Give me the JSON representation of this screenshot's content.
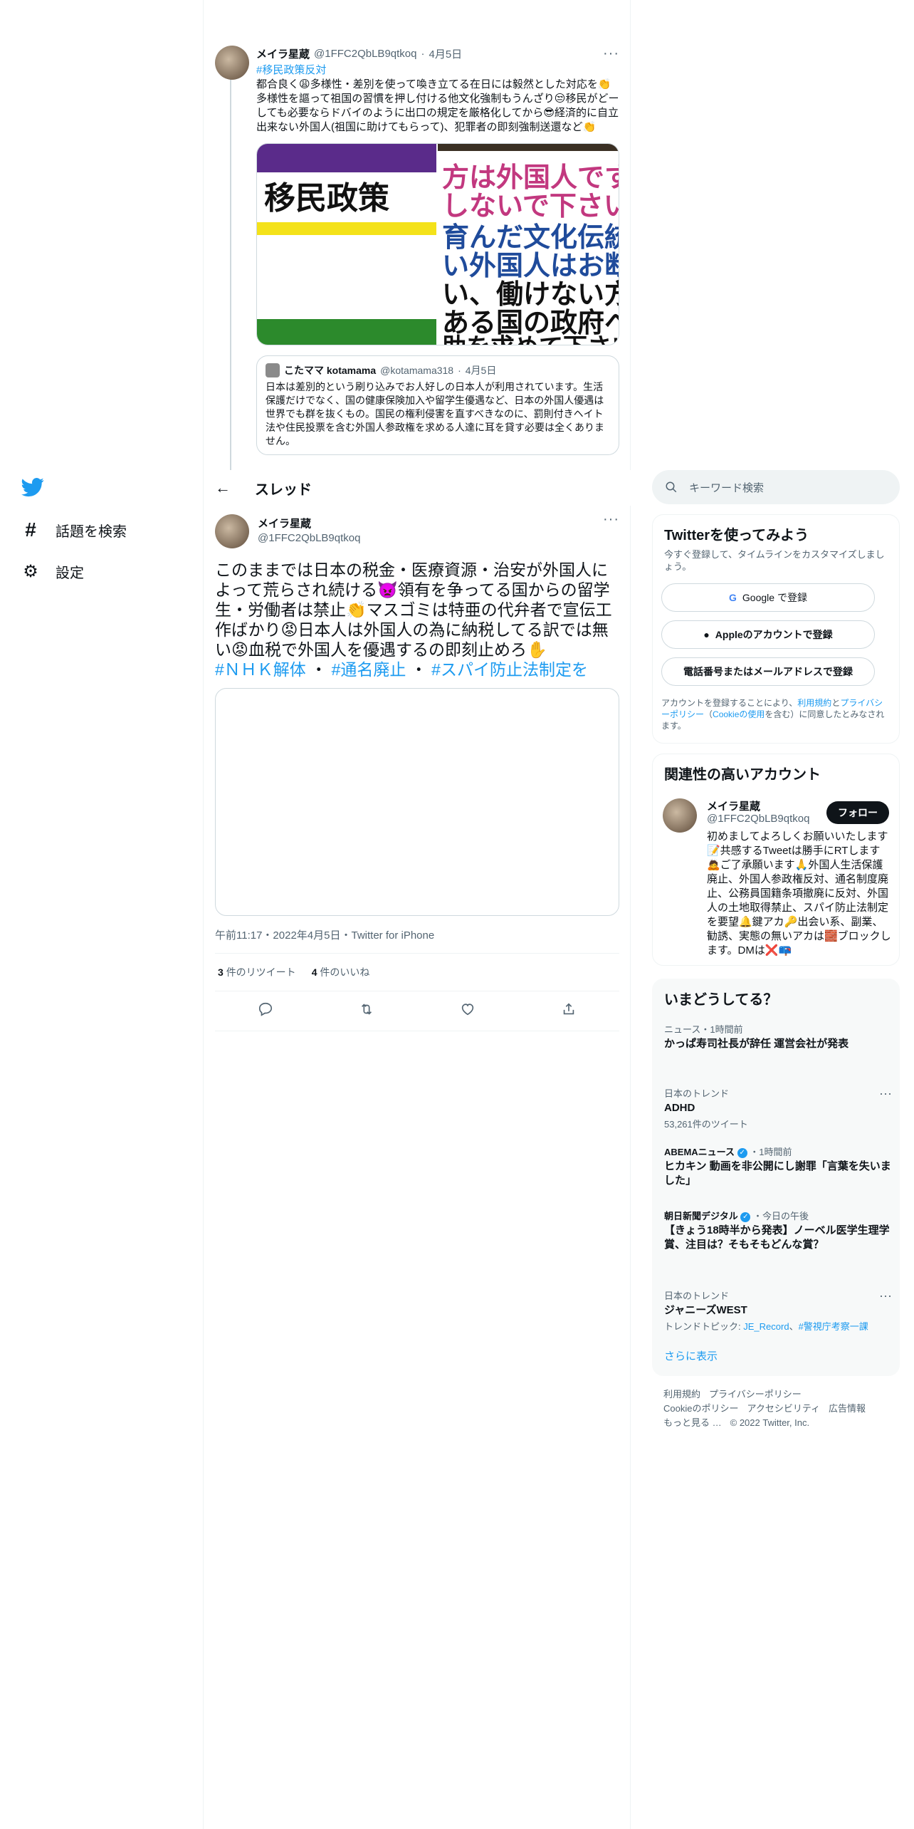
{
  "nav": {
    "logo": "twitter-logo",
    "items": [
      {
        "icon": "#",
        "label": "話題を検索"
      },
      {
        "icon": "⚙",
        "label": "設定"
      }
    ]
  },
  "prev_tweet": {
    "name": "メイラ星蔵",
    "handle": "@1FFC2QbLB9qtkoq",
    "date": "4月5日",
    "hashtag": "#移民政策反対",
    "text": "都合良く😩多様性・差別を使って喚き立てる在日には毅然とした対応を👏多様性を謳って祖国の習慣を押し付ける他文化強制もうんざり😒移民がどーしても必要ならドバイのように出口の規定を厳格化してから😎経済的に自立出来ない外国人(祖国に助けてもらって)、犯罪者の即刻強制送還など👏",
    "image1_text": "移民政策",
    "image2_lines": [
      "方は外国人です",
      "しないで下さい",
      "育んだ文化伝統を",
      "い外国人はお断り",
      "い、働けない方は",
      "ある国の政府へと",
      "助を求めて下さい"
    ],
    "quote": {
      "name": "こたママ kotamama",
      "handle": "@kotamama318",
      "date": "4月5日",
      "text": "日本は差別的という刷り込みでお人好しの日本人が利用されています。生活保護だけでなく、国の健康保険加入や留学生優遇など、日本の外国人優遇は世界でも群を抜くもの。国民の権利侵害を直すべきなのに、罰則付きヘイト法や住民投票を含む外国人参政権を求める人達に耳を貸す必要は全くありません。"
    }
  },
  "header": {
    "back": "←",
    "title": "スレッド"
  },
  "main_tweet": {
    "name": "メイラ星蔵",
    "handle": "@1FFC2QbLB9qtkoq",
    "text": "このままでは日本の税金・医療資源・治安が外国人によって荒らされ続ける👿領有を争ってる国からの留学生・労働者は禁止👏マスゴミは特亜の代弁者で宣伝工作ばかり😡日本人は外国人の為に納税してる訳では無い😡血税で外国人を優遇するの即刻止めろ✋",
    "hashtags": [
      "#ＮＨＫ解体",
      "#通名廃止",
      "#スパイ防止法制定を"
    ],
    "meta": "午前11:17・2022年4月5日・Twitter for iPhone",
    "retweets": "3",
    "retweets_label": "件のリツイート",
    "likes": "4",
    "likes_label": "件のいいね"
  },
  "search": {
    "placeholder": "キーワード検索"
  },
  "signup": {
    "title": "Twitterを使ってみよう",
    "subtitle": "今すぐ登録して、タイムラインをカスタマイズしましょう。",
    "google": "Google で登録",
    "apple": "Appleのアカウントで登録",
    "phone": "電話番号またはメールアドレスで登録",
    "fine_a": "アカウントを登録することにより、",
    "fine_terms": "利用規約",
    "fine_and": "と",
    "fine_privacy": "プライバシーポリシー",
    "fine_b": "（",
    "fine_cookie": "Cookieの使用",
    "fine_c": "を含む）に同意したとみなされます。"
  },
  "related": {
    "title": "関連性の高いアカウント",
    "name": "メイラ星蔵",
    "handle": "@1FFC2QbLB9qtkoq",
    "follow": "フォロー",
    "bio": "初めましてよろしくお願いいたします📝共感するTweetは勝手にRTします🙇ご了承願います🙏外国人生活保護廃止、外国人参政権反対、通名制度廃止、公務員国籍条項撤廃に反対、外国人の土地取得禁止、スパイ防止法制定を要望🔔鍵アカ🔑出会い系、副業、勧誘、実態の無いアカは🧱ブロックします。DMは❌📪"
  },
  "trends": {
    "title": "いまどうしてる？",
    "items": [
      {
        "context": "ニュース・1時間前",
        "title": "かっぱ寿司社長が辞任 運営会社が発表"
      },
      {
        "context": "日本のトレンド",
        "title": "ADHD",
        "count": "53,261件のツイート"
      },
      {
        "context": "ABEMAニュース",
        "context2": "・1時間前",
        "title": "ヒカキン 動画を非公開にし謝罪「言葉を失いました」"
      },
      {
        "context": "朝日新聞デジタル",
        "context2": "・今日の午後",
        "title": "【きょう18時半から発表】ノーベル医学生理学賞、注目は？そもそもどんな賞？"
      },
      {
        "context": "日本のトレンド",
        "title": "ジャニーズWEST",
        "topic_label": "トレンドトピック:",
        "topic1": "JE_Record",
        "topic_sep": "、",
        "topic2": "#警視庁考察一課"
      }
    ],
    "show_more": "さらに表示"
  },
  "footer": {
    "links": [
      "利用規約",
      "プライバシーポリシー",
      "Cookieのポリシー",
      "アクセシビリティ",
      "広告情報",
      "もっと見る …"
    ],
    "copyright": "© 2022 Twitter, Inc."
  },
  "colors": {
    "accent": "#1d9bf0",
    "text": "#0f1419",
    "muted": "#536471"
  }
}
